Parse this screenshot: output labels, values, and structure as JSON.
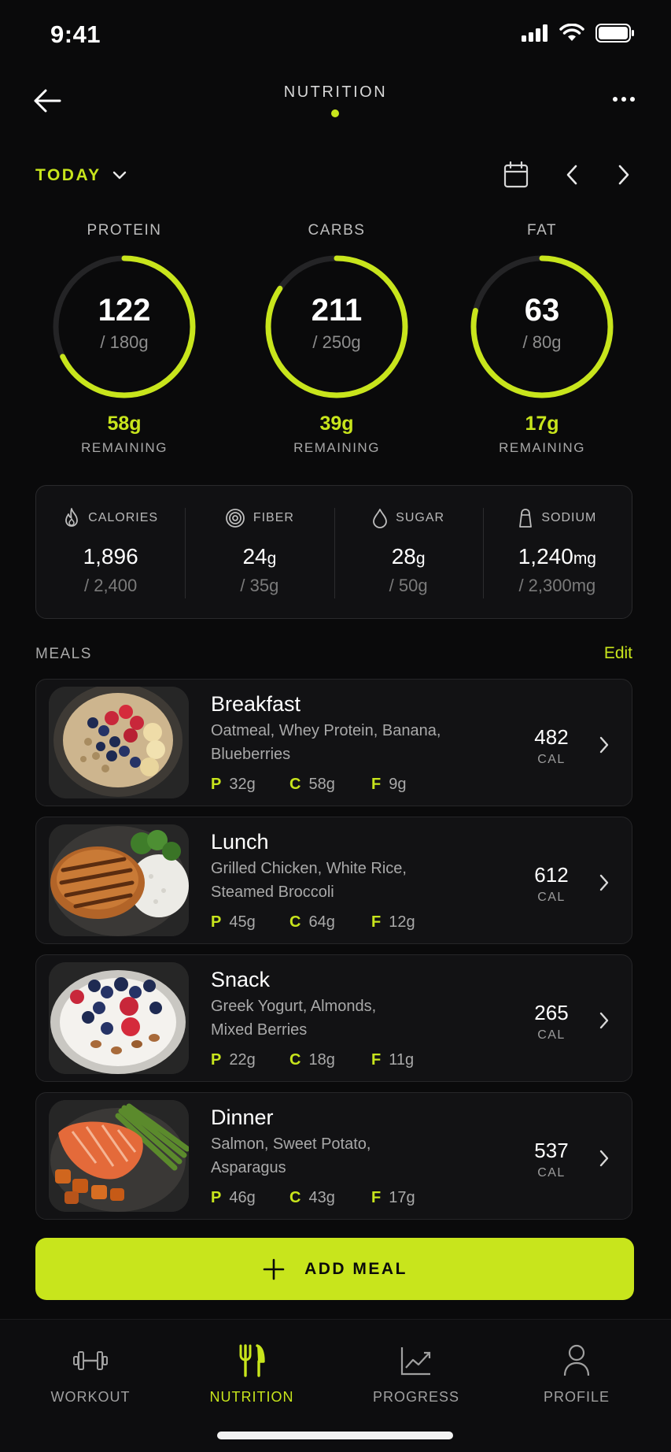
{
  "status_bar": {
    "time": "9:41"
  },
  "header": {
    "title": "NUTRITION"
  },
  "date": {
    "label": "TODAY"
  },
  "macros": [
    {
      "label": "PROTEIN",
      "value": "122",
      "goal": "/ 180g",
      "remaining": "58g",
      "remaining_label": "REMAINING",
      "progress": 0.678
    },
    {
      "label": "CARBS",
      "value": "211",
      "goal": "/ 250g",
      "remaining": "39g",
      "remaining_label": "REMAINING",
      "progress": 0.844
    },
    {
      "label": "FAT",
      "value": "63",
      "goal": "/ 80g",
      "remaining": "17g",
      "remaining_label": "REMAINING",
      "progress": 0.7875
    }
  ],
  "stats": [
    {
      "label": "CALORIES",
      "value": "1,896",
      "unit": "",
      "goal": "/ 2,400",
      "icon": "flame-icon"
    },
    {
      "label": "FIBER",
      "value": "24",
      "unit": "g",
      "goal": "/ 35g",
      "icon": "target-icon"
    },
    {
      "label": "SUGAR",
      "value": "28",
      "unit": "g",
      "goal": "/ 50g",
      "icon": "drop-icon"
    },
    {
      "label": "SODIUM",
      "value": "1,240",
      "unit": "mg",
      "goal": "/ 2,300mg",
      "icon": "salt-shaker-icon"
    }
  ],
  "meals_section": {
    "label": "MEALS",
    "edit": "Edit"
  },
  "meals": [
    {
      "name": "Breakfast",
      "items_line1": "Oatmeal, Whey Protein, Banana,",
      "items_line2": "Blueberries",
      "p": "32g",
      "c": "58g",
      "f": "9g",
      "cal": "482",
      "cal_unit": "CAL"
    },
    {
      "name": "Lunch",
      "items_line1": "Grilled Chicken, White Rice,",
      "items_line2": "Steamed Broccoli",
      "p": "45g",
      "c": "64g",
      "f": "12g",
      "cal": "612",
      "cal_unit": "CAL"
    },
    {
      "name": "Snack",
      "items_line1": "Greek Yogurt, Almonds,",
      "items_line2": "Mixed Berries",
      "p": "22g",
      "c": "18g",
      "f": "11g",
      "cal": "265",
      "cal_unit": "CAL"
    },
    {
      "name": "Dinner",
      "items_line1": "Salmon, Sweet Potato,",
      "items_line2": "Asparagus",
      "p": "46g",
      "c": "43g",
      "f": "17g",
      "cal": "537",
      "cal_unit": "CAL"
    }
  ],
  "macro_letters": {
    "p": "P",
    "c": "C",
    "f": "F"
  },
  "add_meal": {
    "label": "ADD MEAL"
  },
  "tabs": [
    {
      "label": "WORKOUT",
      "icon": "dumbbell-icon"
    },
    {
      "label": "NUTRITION",
      "icon": "fork-knife-icon",
      "active": true
    },
    {
      "label": "PROGRESS",
      "icon": "chart-icon"
    },
    {
      "label": "PROFILE",
      "icon": "person-icon"
    }
  ],
  "colors": {
    "accent": "#c8e51c",
    "background": "#0a0a0b",
    "card": "#121214"
  }
}
